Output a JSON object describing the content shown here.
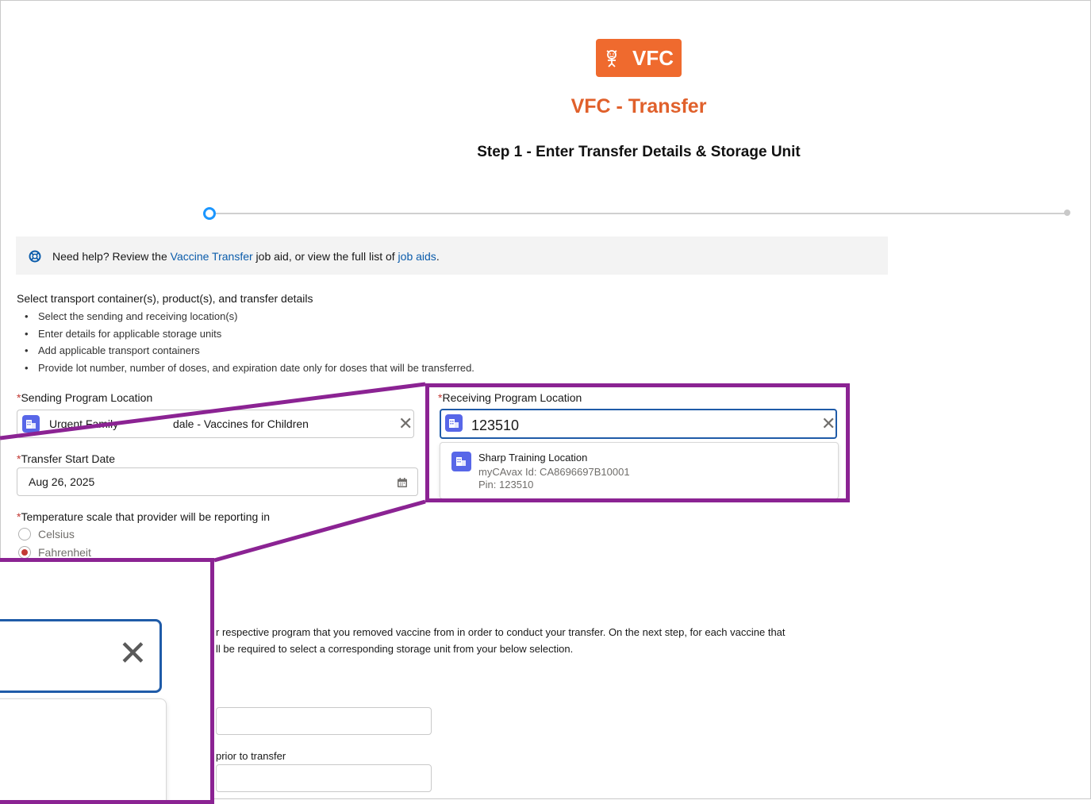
{
  "header": {
    "logo_text": "VFC",
    "app_title": "VFC - Transfer",
    "step_title": "Step 1 - Enter Transfer Details & Storage Unit"
  },
  "help": {
    "prefix": "Need help? Review the ",
    "link1": "Vaccine Transfer",
    "middle": " job aid, or view the full list of ",
    "link2": "job aids",
    "suffix": "."
  },
  "instructions": {
    "heading": "Select transport container(s), product(s), and transfer details",
    "bullets": [
      "Select the sending and receiving location(s)",
      "Enter details for applicable storage units",
      "Add applicable transport containers",
      "Provide lot number, number of doses, and expiration date only for doses that will be transferred."
    ]
  },
  "form": {
    "required_mark": "*",
    "sending_label": "Sending Program Location",
    "sending_value_start": "Urgent Family",
    "sending_value_end": "dale - Vaccines for Children",
    "receiving_label": "Receiving Program Location",
    "receiving_value": "123510",
    "transfer_date_label": "Transfer Start Date",
    "transfer_date_value": "Aug 26, 2025",
    "temp_label": "Temperature scale that provider will be reporting in",
    "temp_options": [
      "Celsius",
      "Fahrenheit"
    ],
    "temp_selected": "Fahrenheit"
  },
  "lookup_result": {
    "name": "Sharp Training Location",
    "mycavax": "myCAvax Id: CA8696697B10001",
    "pin": "Pin: 123510"
  },
  "storage": {
    "para_line1": "r respective program that you removed vaccine from in order to conduct your transfer. On the next step, for each vaccine that",
    "para_line2": "ll be required to select a corresponding storage unit from your below selection.",
    "prior_label": "prior to transfer"
  },
  "colors": {
    "brand_orange": "#ef6a2e",
    "callout_purple": "#8b2393",
    "focus_blue": "#1f5ba8",
    "icon_blue": "#5867e8",
    "link_blue": "#0b5cab"
  }
}
